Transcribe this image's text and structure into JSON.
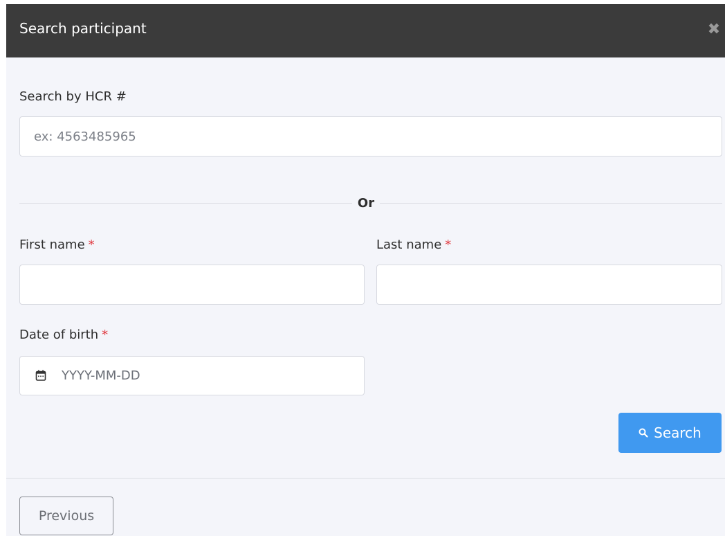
{
  "modal": {
    "title": "Search participant",
    "close_icon": "close-icon"
  },
  "hcr": {
    "label": "Search by HCR #",
    "placeholder": "ex: 4563485965",
    "value": ""
  },
  "divider": {
    "text": "Or"
  },
  "first_name": {
    "label": "First name",
    "required_marker": "*",
    "value": ""
  },
  "last_name": {
    "label": "Last name",
    "required_marker": "*",
    "value": ""
  },
  "dob": {
    "label": "Date of birth",
    "required_marker": "*",
    "placeholder": "YYYY-MM-DD",
    "icon": "calendar-icon"
  },
  "search_button": {
    "label": "Search",
    "icon": "search-icon",
    "color": "#4099f0"
  },
  "footer": {
    "previous_label": "Previous"
  }
}
